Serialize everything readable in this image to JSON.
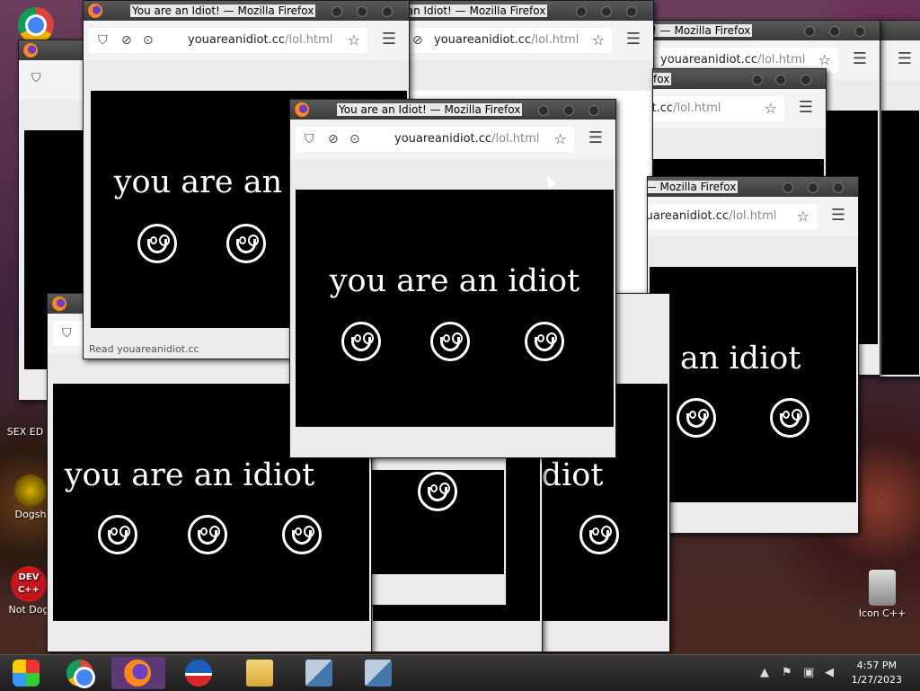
{
  "window_title": "You are an Idiot! — Mozilla Firefox",
  "url_domain": "youareanidiot.cc",
  "url_path": "/lol.html",
  "page_message": "you are an idiot",
  "status_text": "Read youareanidiot.cc",
  "desktop_icons": [
    {
      "label": "SEX ED"
    },
    {
      "label": "Dogsh"
    },
    {
      "label": "Not Dog"
    },
    {
      "label": "Icon C++"
    }
  ],
  "desktop_icon_text": {
    "dev": "DEV",
    "cpp": "C++"
  },
  "taskbar": {
    "items": [
      {
        "name": "Windows Media Center"
      },
      {
        "name": "Google Chrome"
      },
      {
        "name": "Firefox"
      },
      {
        "name": "Obama"
      },
      {
        "name": "File Explorer"
      },
      {
        "name": "Setup"
      },
      {
        "name": "Setup"
      }
    ],
    "time": "4:57 PM",
    "date": "1/27/2023"
  },
  "colors": {
    "page_bg": "#000000",
    "text": "#ffffff",
    "active_taskbar": "#5c3a78"
  }
}
